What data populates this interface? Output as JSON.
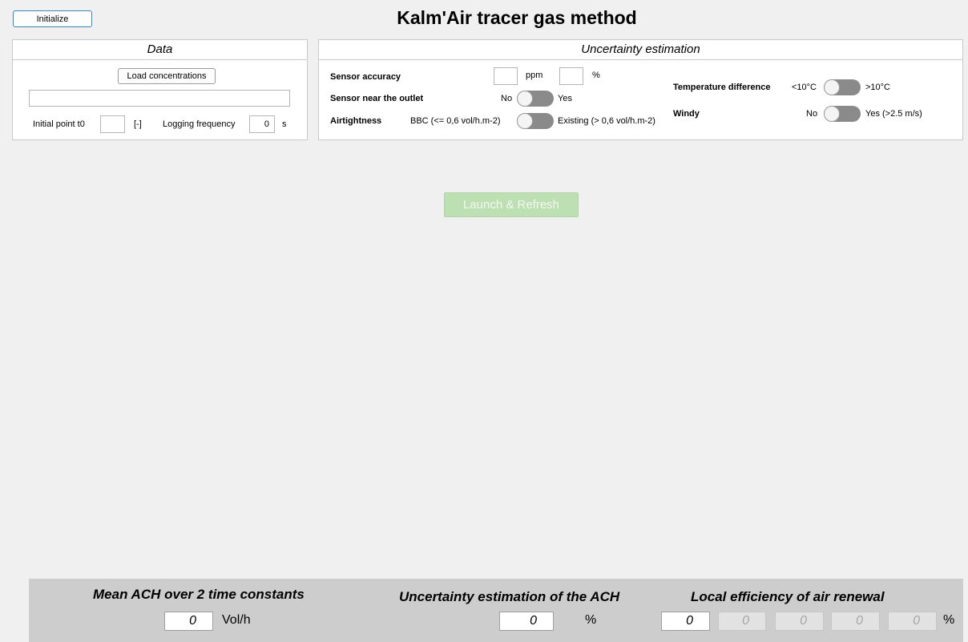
{
  "header": {
    "initialize_label": "Initialize",
    "title": "Kalm'Air tracer gas method"
  },
  "data_panel": {
    "title": "Data",
    "load_label": "Load concentrations",
    "file_path": "",
    "initial_point_label": "Initial point t0",
    "initial_point_value": "",
    "initial_point_unit": "[-]",
    "logging_frequency_label": "Logging frequency",
    "logging_frequency_value": "0",
    "logging_frequency_unit": "s"
  },
  "uncertainty_panel": {
    "title": "Uncertainty estimation",
    "sensor_accuracy_label": "Sensor accuracy",
    "sensor_accuracy_ppm_value": "",
    "sensor_accuracy_ppm_unit": "ppm",
    "sensor_accuracy_pct_value": "",
    "sensor_accuracy_pct_unit": "%",
    "sensor_outlet_label": "Sensor near the outlet",
    "sensor_outlet_off": "No",
    "sensor_outlet_on": "Yes",
    "airtightness_label": "Airtightness",
    "airtightness_off": "BBC (<= 0,6 vol/h.m-2)",
    "airtightness_on": "Existing (> 0,6 vol/h.m-2)",
    "temp_diff_label": "Temperature difference",
    "temp_diff_off": "<10°C",
    "temp_diff_on": ">10°C",
    "windy_label": "Windy",
    "windy_off": "No",
    "windy_on": "Yes (>2.5 m/s)"
  },
  "launch_label": "Launch & Refresh",
  "results": {
    "mean_ach_title": "Mean ACH over 2 time constants",
    "mean_ach_value": "0",
    "mean_ach_unit": "Vol/h",
    "uncertainty_title": "Uncertainty estimation of the ACH",
    "uncertainty_value": "0",
    "uncertainty_unit": "%",
    "local_eff_title": "Local efficiency of air renewal",
    "local_eff_values": [
      "0",
      "0",
      "0",
      "0",
      "0"
    ],
    "local_eff_unit": "%"
  },
  "colors": {
    "background": "#f0f0f0",
    "panel": "#ffffff",
    "results_bar": "#cdcdcd",
    "launch_button": "#bde0b3",
    "initialize_border": "#2f89d6",
    "toggle_track": "#8a8a8a"
  }
}
